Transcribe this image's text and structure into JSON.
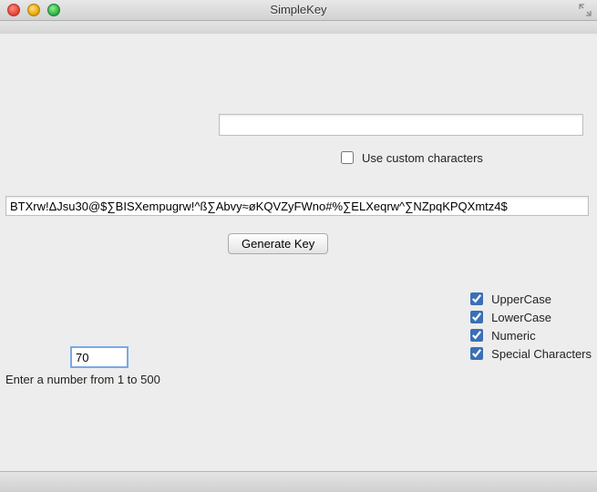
{
  "window": {
    "title": "SimpleKey"
  },
  "custom": {
    "input_value": "",
    "checkbox_label": "Use custom characters",
    "checked": false
  },
  "generated_key": "BTXrw!ΔJsu30@$∑BISXempugrw!^ß∑Abvy≈øKQVZyFWno#%∑ELXeqrw^∑NZpqKPQXmtz4$",
  "generate_button_label": "Generate Key",
  "options": {
    "uppercase": {
      "label": "UpperCase",
      "checked": true
    },
    "lowercase": {
      "label": "LowerCase",
      "checked": true
    },
    "numeric": {
      "label": "Numeric",
      "checked": true
    },
    "special": {
      "label": "Special Characters",
      "checked": true
    }
  },
  "length": {
    "value": "70",
    "hint": "Enter a number from 1 to 500"
  }
}
